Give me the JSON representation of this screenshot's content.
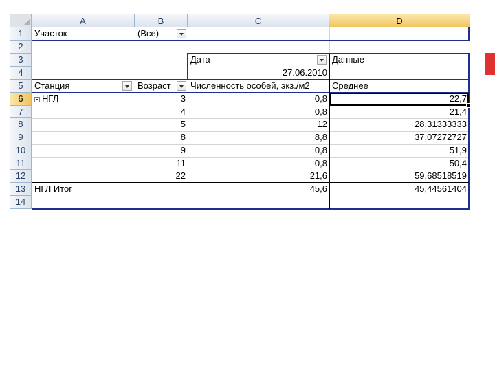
{
  "columns": [
    "A",
    "B",
    "C",
    "D"
  ],
  "rows": [
    "1",
    "2",
    "3",
    "4",
    "5",
    "6",
    "7",
    "8",
    "9",
    "10",
    "11",
    "12",
    "13",
    "14"
  ],
  "active_column": "D",
  "active_row": "6",
  "filter": {
    "label": "Участок",
    "value": "(Все)"
  },
  "pivot": {
    "field_date": "Дата",
    "field_data": "Данные",
    "date_value": "27.06.2010",
    "col_station": "Станция",
    "col_age": "Возраст",
    "col_count": "Численность особей, экз./м2",
    "col_mean": "Среднее",
    "group": "НГЛ",
    "records": [
      {
        "age": "3",
        "count": "0,8",
        "mean": "22,7"
      },
      {
        "age": "4",
        "count": "0,8",
        "mean": "21,4"
      },
      {
        "age": "5",
        "count": "12",
        "mean": "28,31333333"
      },
      {
        "age": "8",
        "count": "8,8",
        "mean": "37,07272727"
      },
      {
        "age": "9",
        "count": "0,8",
        "mean": "51,9"
      },
      {
        "age": "11",
        "count": "0,8",
        "mean": "50,4"
      },
      {
        "age": "22",
        "count": "21,6",
        "mean": "59,68518519"
      }
    ],
    "total_label": "НГЛ Итог",
    "total_count": "45,6",
    "total_mean": "45,44561404"
  },
  "colors": {
    "pivot_border": "#1f2f8f",
    "header_selected": "#f1c560",
    "accent_bar": "#e03030"
  }
}
